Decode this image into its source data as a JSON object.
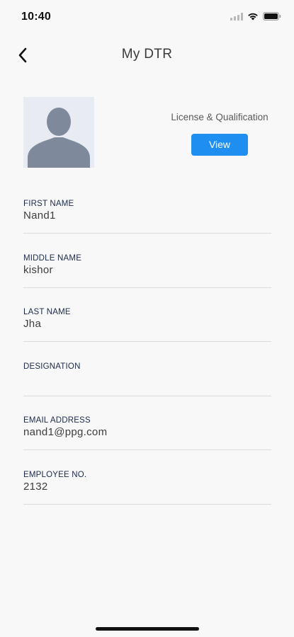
{
  "status_bar": {
    "time": "10:40"
  },
  "nav": {
    "title": "My DTR",
    "back_icon": "chevron-left-icon"
  },
  "profile": {
    "avatar_icon": "person-placeholder-icon",
    "license_label": "License & Qualification",
    "view_button_label": "View"
  },
  "fields": [
    {
      "label": "FIRST NAME",
      "value": "Nand1"
    },
    {
      "label": "MIDDLE NAME",
      "value": "kishor"
    },
    {
      "label": "LAST NAME",
      "value": "Jha"
    },
    {
      "label": "DESIGNATION",
      "value": ""
    },
    {
      "label": "EMAIL ADDRESS",
      "value": "nand1@ppg.com"
    },
    {
      "label": "EMPLOYEE NO.",
      "value": "2132"
    }
  ],
  "colors": {
    "accent": "#1f8ef1",
    "background": "#f8f8f9",
    "label": "#1b2a4a",
    "divider": "#d9dbe0",
    "avatar_bg": "#e8ebf1",
    "avatar_fg": "#7e8a9c"
  }
}
